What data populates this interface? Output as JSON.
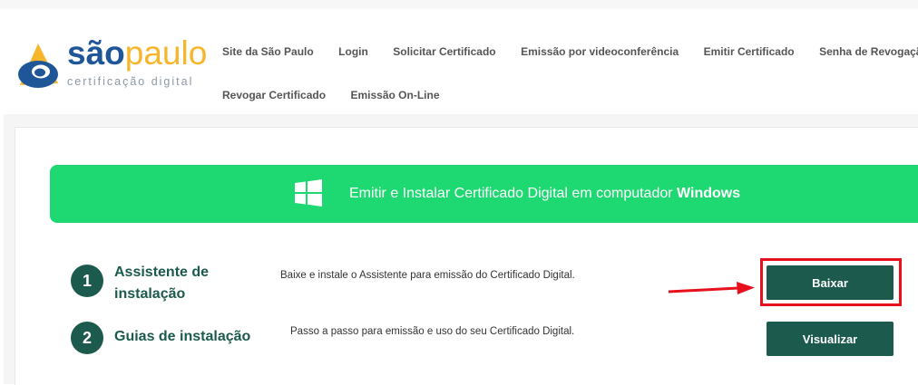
{
  "brand": {
    "name_bold": "são",
    "name_light": "paulo",
    "subtitle": "certificação digital"
  },
  "nav": {
    "row1": [
      "Site da São Paulo",
      "Login",
      "Solicitar Certificado",
      "Emissão por videoconferência",
      "Emitir Certificado",
      "Senha de Revogação"
    ],
    "row2": [
      "Revogar Certificado",
      "Emissão On-Line"
    ]
  },
  "banner": {
    "text": "Emitir e Instalar Certificado Digital em computador ",
    "bold": "Windows",
    "icon": "windows-icon"
  },
  "steps": [
    {
      "number": "1",
      "title": "Assistente de instalação",
      "description": "Baixe e instale o Assistente para emissão do Certificado Digital.",
      "button": "Baixar"
    },
    {
      "number": "2",
      "title": "Guias de instalação",
      "description": "Passo a passo para emissão e uso do seu Certificado Digital.",
      "button": "Visualizar"
    }
  ],
  "colors": {
    "brand_blue": "#1f5698",
    "brand_gold": "#f6b52a",
    "green_banner": "#1ed872",
    "dark_green": "#1b5a4c",
    "highlight_red": "#e8101c"
  }
}
